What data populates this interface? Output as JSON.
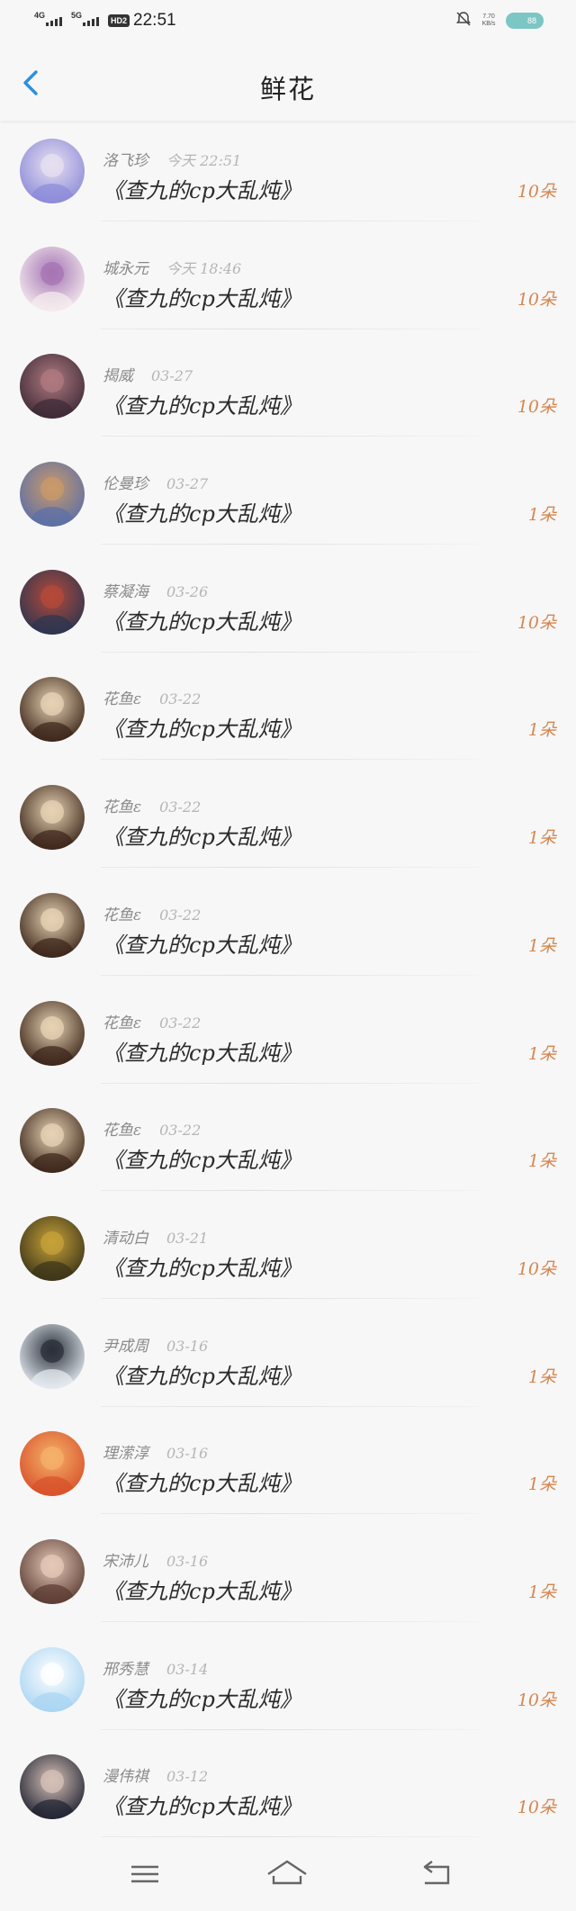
{
  "status_bar": {
    "network_1": "4G",
    "network_2": "5G",
    "hd_badge": "HD2",
    "time": "22:51",
    "speed_value": "7.70",
    "speed_unit": "KB/s",
    "battery": "88"
  },
  "header": {
    "title": "鲜花",
    "back_icon": "chevron-left-icon"
  },
  "gifts": [
    {
      "name": "洛飞珍",
      "date": "今天 22:51",
      "title": "《查九的cp大乱炖》",
      "count": "10朵",
      "avatar_colors": [
        "#8c8ad9",
        "#e6e0f0"
      ]
    },
    {
      "name": "城永元",
      "date": "今天 18:46",
      "title": "《查九的cp大乱炖》",
      "count": "10朵",
      "avatar_colors": [
        "#f6eef0",
        "#a574b3"
      ]
    },
    {
      "name": "揭威",
      "date": "03-27",
      "title": "《查九的cp大乱炖》",
      "count": "10朵",
      "avatar_colors": [
        "#3c2a36",
        "#b07a80"
      ]
    },
    {
      "name": "伦曼珍",
      "date": "03-27",
      "title": "《查九的cp大乱炖》",
      "count": "1朵",
      "avatar_colors": [
        "#5b6fa8",
        "#c99a6a"
      ]
    },
    {
      "name": "蔡凝海",
      "date": "03-26",
      "title": "《查九的cp大乱炖》",
      "count": "10朵",
      "avatar_colors": [
        "#2c3550",
        "#b44a3a"
      ]
    },
    {
      "name": "花鱼ε",
      "date": "03-22",
      "title": "《查九的cp大乱炖》",
      "count": "1朵",
      "avatar_colors": [
        "#3a2418",
        "#e7d3b4"
      ]
    },
    {
      "name": "花鱼ε",
      "date": "03-22",
      "title": "《查九的cp大乱炖》",
      "count": "1朵",
      "avatar_colors": [
        "#3a2418",
        "#e7d3b4"
      ]
    },
    {
      "name": "花鱼ε",
      "date": "03-22",
      "title": "《查九的cp大乱炖》",
      "count": "1朵",
      "avatar_colors": [
        "#3a2418",
        "#e7d3b4"
      ]
    },
    {
      "name": "花鱼ε",
      "date": "03-22",
      "title": "《查九的cp大乱炖》",
      "count": "1朵",
      "avatar_colors": [
        "#3a2418",
        "#e7d3b4"
      ]
    },
    {
      "name": "花鱼ε",
      "date": "03-22",
      "title": "《查九的cp大乱炖》",
      "count": "1朵",
      "avatar_colors": [
        "#3a2418",
        "#e7d3b4"
      ]
    },
    {
      "name": "清动白",
      "date": "03-21",
      "title": "《查九的cp大乱炖》",
      "count": "10朵",
      "avatar_colors": [
        "#3a3318",
        "#c7a23a"
      ]
    },
    {
      "name": "尹成周",
      "date": "03-16",
      "title": "《查九的cp大乱炖》",
      "count": "1朵",
      "avatar_colors": [
        "#e8eef4",
        "#2a2f3a"
      ]
    },
    {
      "name": "理潆淳",
      "date": "03-16",
      "title": "《查九的cp大乱炖》",
      "count": "1朵",
      "avatar_colors": [
        "#d8502a",
        "#f4b26a"
      ]
    },
    {
      "name": "宋沛儿",
      "date": "03-16",
      "title": "《查九的cp大乱炖》",
      "count": "1朵",
      "avatar_colors": [
        "#5a3b32",
        "#e6c9b8"
      ]
    },
    {
      "name": "邢秀慧",
      "date": "03-14",
      "title": "《查九的cp大乱炖》",
      "count": "10朵",
      "avatar_colors": [
        "#a8d4f2",
        "#ffffff"
      ]
    },
    {
      "name": "漫伟祺",
      "date": "03-12",
      "title": "《查九的cp大乱炖》",
      "count": "10朵",
      "avatar_colors": [
        "#1f2232",
        "#d7c2b8"
      ]
    }
  ],
  "nav_bar": {
    "menu_icon": "menu-icon",
    "home_icon": "home-icon",
    "back_icon": "back-arrow-icon"
  },
  "colors": {
    "accent_blue": "#2b8fe0",
    "count_orange": "#d7864f",
    "background": "#f7f7f7"
  }
}
